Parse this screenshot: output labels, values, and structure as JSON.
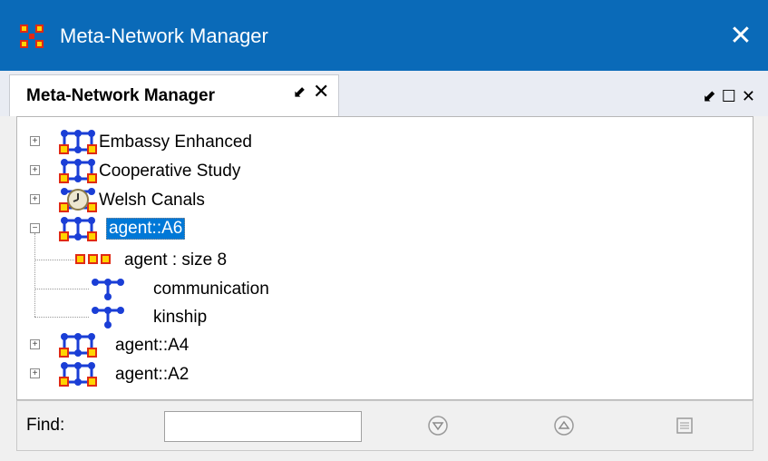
{
  "window": {
    "title": "Meta-Network Manager",
    "close_icon": "close-icon"
  },
  "tab": {
    "label": "Meta-Network Manager"
  },
  "tree": {
    "items": [
      {
        "label": "Embassy Enhanced",
        "icon": "meta-network-icon"
      },
      {
        "label": "Cooperative Study",
        "icon": "meta-network-icon"
      },
      {
        "label": "Welsh Canals",
        "icon": "meta-network-clock-icon"
      },
      {
        "label": "agent::A6",
        "icon": "meta-network-icon",
        "selected": true
      },
      {
        "label": "agent : size 8",
        "icon": "nodeset-icon"
      },
      {
        "label": "communication",
        "icon": "network-icon"
      },
      {
        "label": "kinship",
        "icon": "network-icon"
      },
      {
        "label": "agent::A4",
        "icon": "meta-network-icon"
      },
      {
        "label": "agent::A2",
        "icon": "meta-network-icon"
      }
    ]
  },
  "find": {
    "label": "Find:",
    "value": ""
  },
  "colors": {
    "title_bar": "#0a6ab8",
    "selection": "#0078d7",
    "icon_blue": "#1a3ed6",
    "icon_red": "#e02a14",
    "icon_yellow": "#ffd400"
  }
}
